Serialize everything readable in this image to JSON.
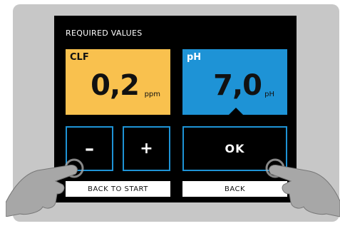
{
  "screen": {
    "title": "REQUIRED VALUES",
    "clf": {
      "label": "CLF",
      "value": "0,2",
      "unit": "ppm",
      "color": "#f9c14e"
    },
    "ph": {
      "label": "pH",
      "value": "7,0",
      "unit": "pH",
      "color": "#1e93d6"
    },
    "buttons": {
      "minus": "–",
      "plus": "+",
      "ok": "OK"
    },
    "bottom": {
      "left": "BACK TO START",
      "right": "BACK"
    }
  },
  "icons": [
    "left-hand-pointer-icon",
    "right-hand-pointer-icon"
  ]
}
